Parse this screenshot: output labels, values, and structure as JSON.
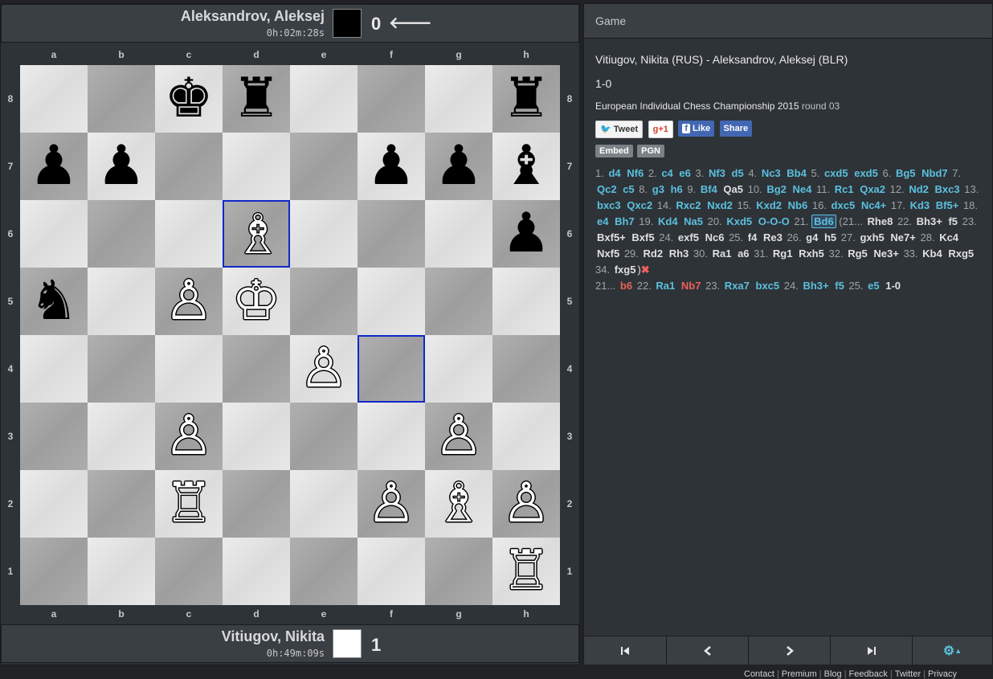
{
  "top_player": {
    "name": "Aleksandrov, Aleksej",
    "clock": "0h:02m:28s",
    "score": "0",
    "color": "black"
  },
  "bottom_player": {
    "name": "Vitiugov, Nikita",
    "clock": "0h:49m:09s",
    "score": "1",
    "color": "white"
  },
  "files": [
    "a",
    "b",
    "c",
    "d",
    "e",
    "f",
    "g",
    "h"
  ],
  "ranks": [
    "8",
    "7",
    "6",
    "5",
    "4",
    "3",
    "2",
    "1"
  ],
  "pieces": {
    "c8": {
      "color": "b",
      "type": "K",
      "glyph": "♚"
    },
    "d8": {
      "color": "b",
      "type": "R",
      "glyph": "♜"
    },
    "h8": {
      "color": "b",
      "type": "R",
      "glyph": "♜"
    },
    "a7": {
      "color": "b",
      "type": "P",
      "glyph": "♟"
    },
    "b7": {
      "color": "b",
      "type": "P",
      "glyph": "♟"
    },
    "f7": {
      "color": "b",
      "type": "P",
      "glyph": "♟"
    },
    "g7": {
      "color": "b",
      "type": "P",
      "glyph": "♟"
    },
    "h7": {
      "color": "b",
      "type": "B",
      "glyph": "♝"
    },
    "d6": {
      "color": "w",
      "type": "B",
      "glyph": "♗"
    },
    "h6": {
      "color": "b",
      "type": "P",
      "glyph": "♟"
    },
    "a5": {
      "color": "b",
      "type": "N",
      "glyph": "♞"
    },
    "c5": {
      "color": "w",
      "type": "P",
      "glyph": "♙"
    },
    "d5": {
      "color": "w",
      "type": "K",
      "glyph": "♔"
    },
    "e4": {
      "color": "w",
      "type": "P",
      "glyph": "♙"
    },
    "c3": {
      "color": "w",
      "type": "P",
      "glyph": "♙"
    },
    "g3": {
      "color": "w",
      "type": "P",
      "glyph": "♙"
    },
    "c2": {
      "color": "w",
      "type": "R",
      "glyph": "♖"
    },
    "f2": {
      "color": "w",
      "type": "P",
      "glyph": "♙"
    },
    "g2": {
      "color": "w",
      "type": "B",
      "glyph": "♗"
    },
    "h2": {
      "color": "w",
      "type": "P",
      "glyph": "♙"
    },
    "h1": {
      "color": "w",
      "type": "R",
      "glyph": "♖"
    }
  },
  "highlighted_squares": [
    "d6",
    "f4"
  ],
  "game_panel": {
    "header": "Game",
    "title": "Vitiugov, Nikita (RUS) - Aleksandrov, Aleksej (BLR)",
    "result": "1-0",
    "event": "European Individual Chess Championship 2015",
    "round": "round 03",
    "social": {
      "tweet": "Tweet",
      "gplus": "+1",
      "like": "Like",
      "share": "Share"
    },
    "tools": {
      "embed": "Embed",
      "pgn": "PGN"
    }
  },
  "moves_main": [
    {
      "n": "1.",
      "w": "d4",
      "b": "Nf6"
    },
    {
      "n": "2.",
      "w": "c4",
      "b": "e6"
    },
    {
      "n": "3.",
      "w": "Nf3",
      "b": "d5"
    },
    {
      "n": "4.",
      "w": "Nc3",
      "b": "Bb4"
    },
    {
      "n": "5.",
      "w": "cxd5",
      "b": "exd5"
    },
    {
      "n": "6.",
      "w": "Bg5",
      "b": "Nbd7"
    },
    {
      "n": "7.",
      "w": "Qc2",
      "b": "c5"
    },
    {
      "n": "8.",
      "w": "g3",
      "b": "h6"
    },
    {
      "n": "9.",
      "w": "Bf4",
      "b": "Qa5",
      "b_style": "alt"
    },
    {
      "n": "10.",
      "w": "Bg2",
      "b": "Ne4"
    },
    {
      "n": "11.",
      "w": "Rc1",
      "b": "Qxa2"
    },
    {
      "n": "12.",
      "w": "Nd2",
      "b": "Bxc3"
    },
    {
      "n": "13.",
      "w": "bxc3",
      "b": "Qxc2"
    },
    {
      "n": "14.",
      "w": "Rxc2",
      "b": "Nxd2"
    },
    {
      "n": "15.",
      "w": "Kxd2",
      "b": "Nb6"
    },
    {
      "n": "16.",
      "w": "dxc5",
      "b": "Nc4+"
    },
    {
      "n": "17.",
      "w": "Kd3",
      "b": "Bf5+"
    },
    {
      "n": "18.",
      "w": "e4",
      "b": "Bh7"
    },
    {
      "n": "19.",
      "w": "Kd4",
      "b": "Na5"
    },
    {
      "n": "20.",
      "w": "Kxd5",
      "b": "O-O-O"
    },
    {
      "n": "21.",
      "w": "Bd6",
      "b": ""
    }
  ],
  "variation": [
    {
      "n": "(21...",
      "b": "Rhe8"
    },
    {
      "n": "22.",
      "w": "Bh3+",
      "b": "f5"
    },
    {
      "n": "23.",
      "w": "Bxf5+",
      "b": "Bxf5"
    },
    {
      "n": "24.",
      "w": "exf5",
      "b": "Nc6"
    },
    {
      "n": "25.",
      "w": "f4",
      "b": "Re3"
    },
    {
      "n": "26.",
      "w": "g4",
      "b": "h5"
    },
    {
      "n": "27.",
      "w": "gxh5",
      "b": "Ne7+"
    },
    {
      "n": "28.",
      "w": "Kc4",
      "b": "Nxf5"
    },
    {
      "n": "29.",
      "w": "Rd2",
      "b": "Rh3"
    },
    {
      "n": "30.",
      "w": "Ra1",
      "b": "a6"
    },
    {
      "n": "31.",
      "w": "Rg1",
      "b": "Rxh5"
    },
    {
      "n": "32.",
      "w": "Rg5",
      "b": "Ne3+"
    },
    {
      "n": "33.",
      "w": "Kb4",
      "b": "Rxg5"
    },
    {
      "n": "34.",
      "w": "fxg5",
      "b": ""
    }
  ],
  "continuation": [
    {
      "n": "21...",
      "b": "b6",
      "b_style": "bad"
    },
    {
      "n": "22.",
      "w": "Ra1",
      "b": "Nb7",
      "b_style": "bad"
    },
    {
      "n": "23.",
      "w": "Rxa7",
      "b": "bxc5"
    },
    {
      "n": "24.",
      "w": "Bh3+",
      "b": "f5"
    },
    {
      "n": "25.",
      "w": "e5",
      "b": "1-0",
      "b_style": "res"
    }
  ],
  "nav": {
    "first_icon": "first-move-icon",
    "prev_icon": "previous-move-icon",
    "next_icon": "next-move-icon",
    "last_icon": "last-move-icon",
    "settings_icon": "gear-icon"
  },
  "footer": [
    "Contact",
    "Premium",
    "Blog",
    "Feedback",
    "Twitter",
    "Privacy"
  ],
  "colors": {
    "link": "#5bc0de",
    "bad_move": "#ee5f5b",
    "highlight": "#1028c8",
    "panel": "#2e3338",
    "bar": "#3a3f44"
  }
}
